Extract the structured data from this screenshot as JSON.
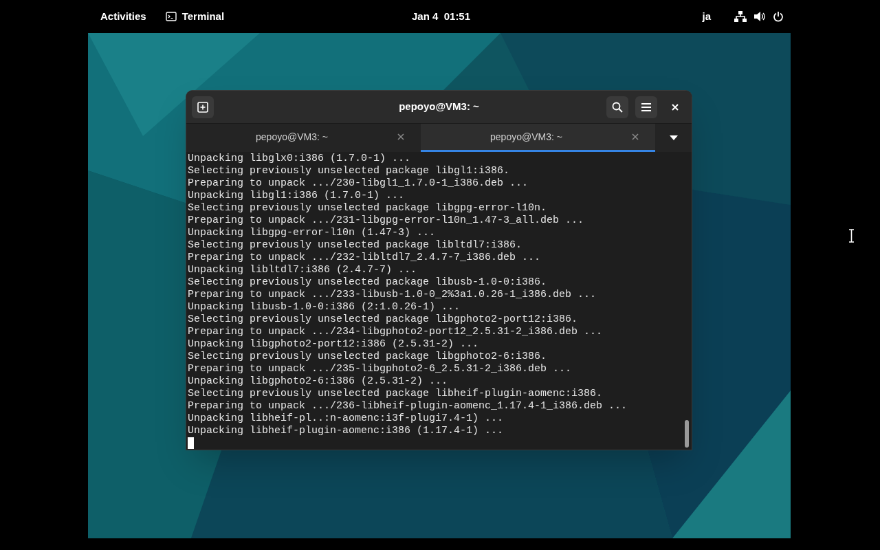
{
  "top_bar": {
    "activities": "Activities",
    "app_name": "Terminal",
    "clock": "Jan 4  01:51",
    "input_method": "ja"
  },
  "window": {
    "title": "pepoyo@VM3: ~"
  },
  "tabs": [
    {
      "label": "pepoyo@VM3: ~",
      "selected": false
    },
    {
      "label": "pepoyo@VM3: ~",
      "selected": true
    }
  ],
  "terminal_lines": [
    "Unpacking libglx0:i386 (1.7.0-1) ...",
    "Selecting previously unselected package libgl1:i386.",
    "Preparing to unpack .../230-libgl1_1.7.0-1_i386.deb ...",
    "Unpacking libgl1:i386 (1.7.0-1) ...",
    "Selecting previously unselected package libgpg-error-l10n.",
    "Preparing to unpack .../231-libgpg-error-l10n_1.47-3_all.deb ...",
    "Unpacking libgpg-error-l10n (1.47-3) ...",
    "Selecting previously unselected package libltdl7:i386.",
    "Preparing to unpack .../232-libltdl7_2.4.7-7_i386.deb ...",
    "Unpacking libltdl7:i386 (2.4.7-7) ...",
    "Selecting previously unselected package libusb-1.0-0:i386.",
    "Preparing to unpack .../233-libusb-1.0-0_2%3a1.0.26-1_i386.deb ...",
    "Unpacking libusb-1.0-0:i386 (2:1.0.26-1) ...",
    "Selecting previously unselected package libgphoto2-port12:i386.",
    "Preparing to unpack .../234-libgphoto2-port12_2.5.31-2_i386.deb ...",
    "Unpacking libgphoto2-port12:i386 (2.5.31-2) ...",
    "Selecting previously unselected package libgphoto2-6:i386.",
    "Preparing to unpack .../235-libgphoto2-6_2.5.31-2_i386.deb ...",
    "Unpacking libgphoto2-6:i386 (2.5.31-2) ...",
    "Selecting previously unselected package libheif-plugin-aomenc:i386.",
    "Preparing to unpack .../236-libheif-plugin-aomenc_1.17.4-1_i386.deb ...",
    "Unpacking libheif-pl..:n-aomenc:i3f-plugi7.4-1) ...",
    "Unpacking libheif-plugin-aomenc:i386 (1.17.4-1) ..."
  ]
}
